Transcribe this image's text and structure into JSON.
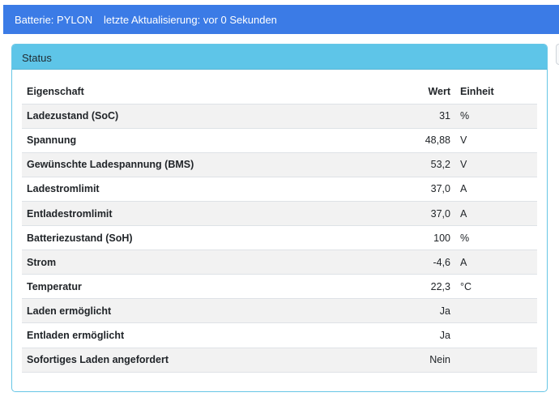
{
  "header": {
    "battery": "Batterie: PYLON",
    "updated": "letzte Aktualisierung: vor 0 Sekunden"
  },
  "card": {
    "title": "Status"
  },
  "table": {
    "columns": {
      "property": "Eigenschaft",
      "value": "Wert",
      "unit": "Einheit"
    },
    "rows": [
      {
        "property": "Ladezustand (SoC)",
        "value": "31",
        "unit": "%"
      },
      {
        "property": "Spannung",
        "value": "48,88",
        "unit": "V"
      },
      {
        "property": "Gewünschte Ladespannung (BMS)",
        "value": "53,2",
        "unit": "V"
      },
      {
        "property": "Ladestromlimit",
        "value": "37,0",
        "unit": "A"
      },
      {
        "property": "Entladestromlimit",
        "value": "37,0",
        "unit": "A"
      },
      {
        "property": "Batteriezustand (SoH)",
        "value": "100",
        "unit": "%"
      },
      {
        "property": "Strom",
        "value": "-4,6",
        "unit": "A"
      },
      {
        "property": "Temperatur",
        "value": "22,3",
        "unit": "°C"
      },
      {
        "property": "Laden ermöglicht",
        "value": "Ja",
        "unit": ""
      },
      {
        "property": "Entladen ermöglicht",
        "value": "Ja",
        "unit": ""
      },
      {
        "property": "Sofortiges Laden angefordert",
        "value": "Nein",
        "unit": ""
      }
    ]
  },
  "colors": {
    "header_bg": "#3b7be6",
    "card_header_bg": "#5ec5e8",
    "stripe": "#f2f2f2"
  }
}
